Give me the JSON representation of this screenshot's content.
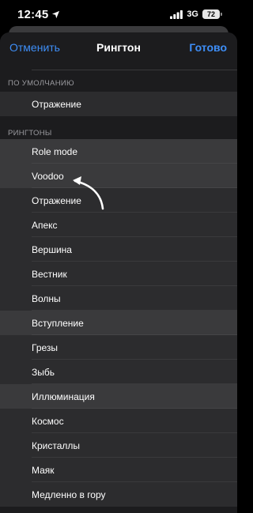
{
  "status": {
    "time": "12:45",
    "network": "3G",
    "battery": "72"
  },
  "nav": {
    "cancel": "Отменить",
    "title": "Рингтон",
    "done": "Готово"
  },
  "default_section": {
    "header": "ПО УМОЛЧАНИЮ",
    "items": [
      {
        "label": "Отражение"
      }
    ]
  },
  "ringtones_section": {
    "header": "РИНГТОНЫ",
    "items": [
      {
        "label": "Role mode"
      },
      {
        "label": "Voodoo"
      },
      {
        "label": "Отражение"
      },
      {
        "label": "Апекс"
      },
      {
        "label": "Вершина"
      },
      {
        "label": "Вестник"
      },
      {
        "label": "Волны"
      },
      {
        "label": "Вступление"
      },
      {
        "label": "Грезы"
      },
      {
        "label": "Зыбь"
      },
      {
        "label": "Иллюминация"
      },
      {
        "label": "Космос"
      },
      {
        "label": "Кристаллы"
      },
      {
        "label": "Маяк"
      },
      {
        "label": "Медленно в гору"
      }
    ]
  },
  "colors": {
    "accent": "#3e8ef7",
    "sheet_bg": "#1c1c1e",
    "row_bg": "#2c2c2e",
    "row_selected": "#3a3a3c"
  }
}
